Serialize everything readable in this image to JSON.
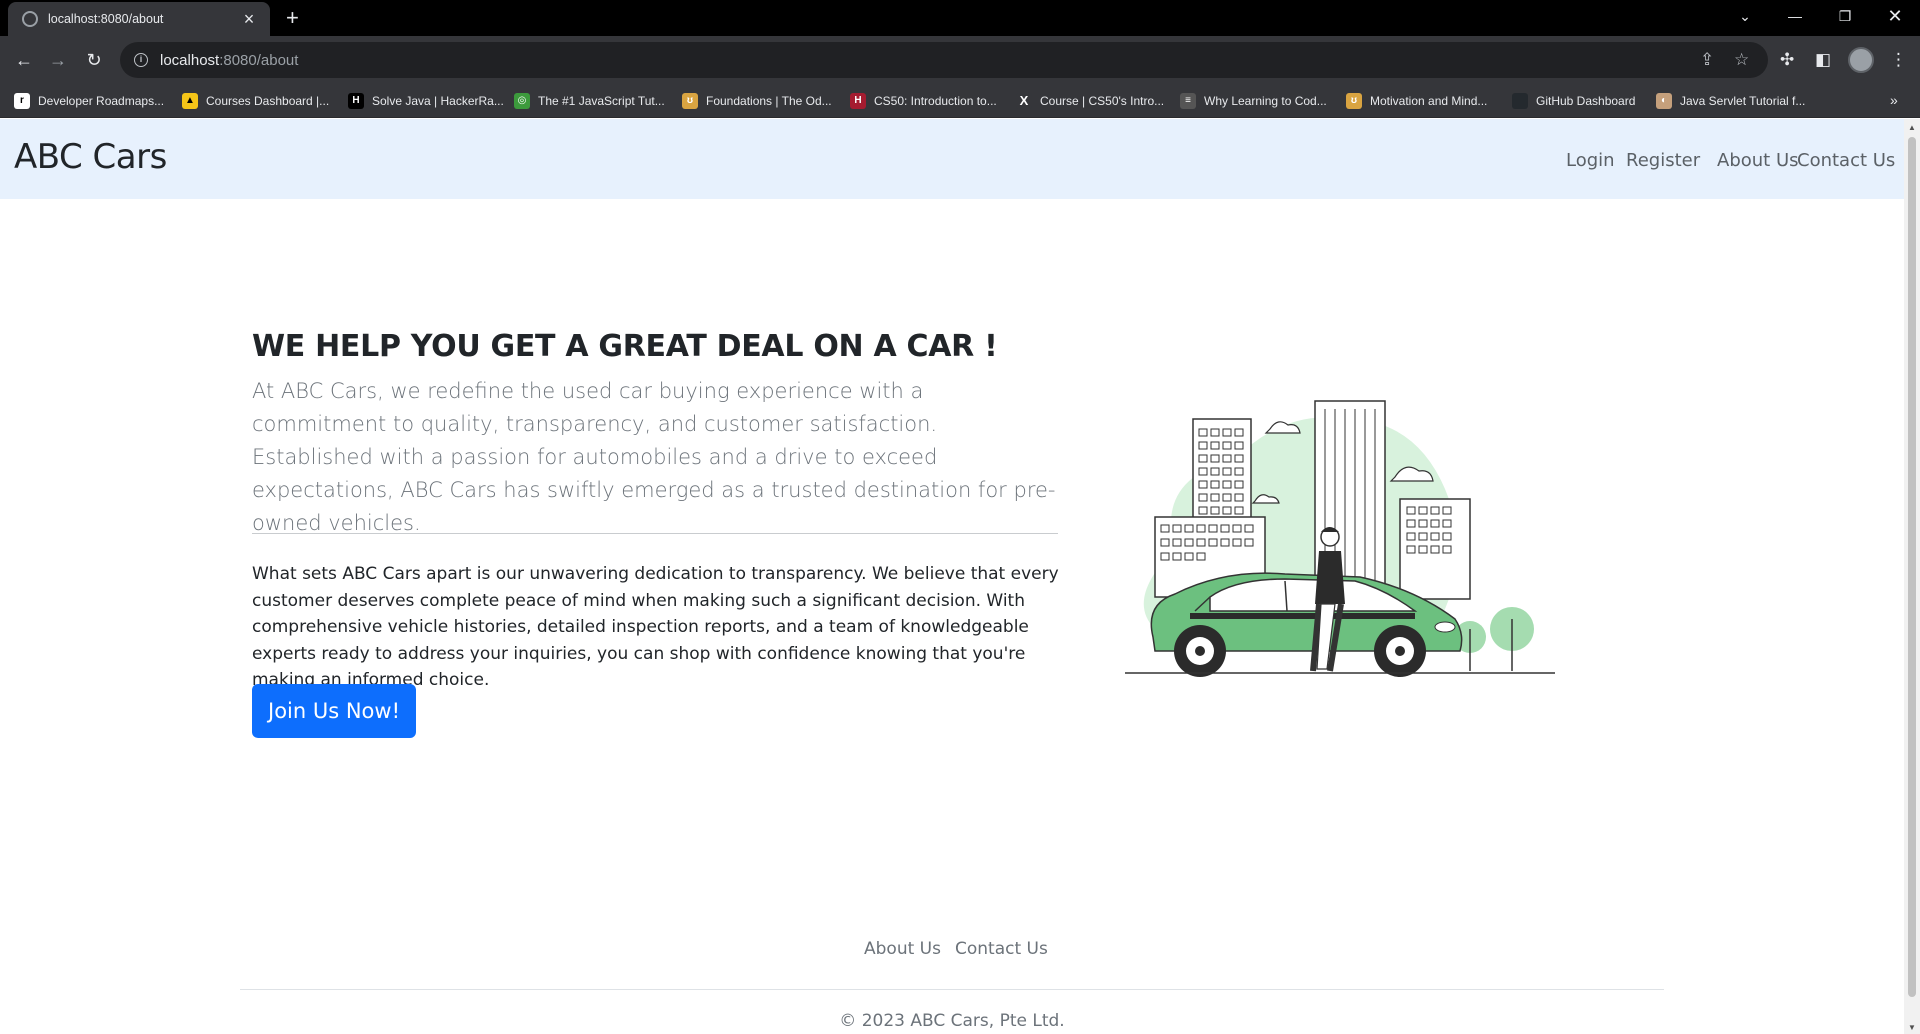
{
  "browser": {
    "tab_title": "localhost:8080/about",
    "url_host": "localhost",
    "url_path": ":8080/about",
    "bookmarks": [
      "Developer Roadmaps...",
      "Courses Dashboard |...",
      "Solve Java | HackerRa...",
      "The #1 JavaScript Tut...",
      "Foundations | The Od...",
      "CS50: Introduction to...",
      "Course | CS50's Intro...",
      "Why Learning to Cod...",
      "Motivation and Mind...",
      "GitHub Dashboard",
      "Java Servlet Tutorial f..."
    ]
  },
  "navbar": {
    "brand": "ABC Cars",
    "links": [
      "Login",
      "Register",
      "About Us",
      "Contact Us"
    ]
  },
  "hero": {
    "title": "WE HELP YOU GET A GREAT DEAL ON A CAR !",
    "lead": "At ABC Cars, we redefine the used car buying experience with a commitment to quality, transparency, and customer satisfaction. Established with a passion for automobiles and a drive to exceed expectations, ABC Cars has swiftly emerged as a trusted destination for pre-owned vehicles.",
    "body": "What sets ABC Cars apart is our unwavering dedication to transparency. We believe that every customer deserves complete peace of mind when making such a significant decision. With comprehensive vehicle histories, detailed inspection reports, and a team of knowledgeable experts ready to address your inquiries, you can shop with confidence knowing that you're making an informed choice.",
    "cta": "Join Us Now!"
  },
  "footer": {
    "links": [
      "About Us",
      "Contact Us"
    ],
    "copyright": "© 2023 ABC Cars, Pte Ltd."
  },
  "colors": {
    "navbar_bg": "#e7f1fd",
    "primary_button": "#0d6efd",
    "illustration_green": "#6cc07f"
  }
}
